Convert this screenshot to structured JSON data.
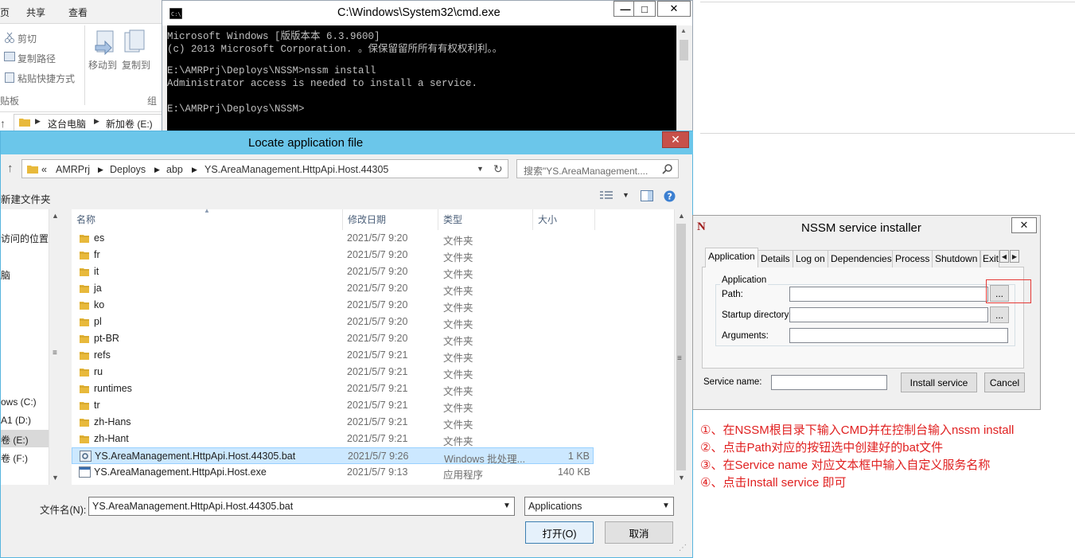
{
  "explorer": {
    "tabs": [
      "页",
      "共享",
      "查看"
    ],
    "commands": {
      "cut": "剪切",
      "copy_path": "复制路径",
      "paste_shortcut": "粘贴快捷方式",
      "move_to": "移动到",
      "copy_to": "复制到"
    },
    "groups": {
      "clipboard": "贴板",
      "organize": "组"
    },
    "breadcrumb": [
      "这台电脑",
      "新加卷 (E:)"
    ]
  },
  "cmd": {
    "title": "C:\\Windows\\System32\\cmd.exe",
    "lines": [
      "Microsoft Windows [版版本本 6.3.9600]",
      "(c) 2013 Microsoft Corporation. 。保保留留所所有有权权利利。。",
      "",
      "E:\\AMRPrj\\Deploys\\NSSM>nssm install",
      "Administrator access is needed to install a service.",
      "",
      "E:\\AMRPrj\\Deploys\\NSSM>"
    ],
    "min_label": "—",
    "max_label": "□",
    "close_label": "✕"
  },
  "dialog": {
    "title": "Locate application file",
    "close_label": "✕",
    "address": {
      "prefix": "«",
      "crumbs": [
        "AMRPrj",
        "Deploys",
        "abp",
        "YS.AreaManagement.HttpApi.Host.44305"
      ]
    },
    "search_placeholder": "搜索\"YS.AreaManagement....",
    "new_folder": "新建文件夹",
    "left_items": [
      "访问的位置",
      "脑",
      "ows (C:)",
      "A1 (D:)",
      "卷 (E:)",
      "卷 (F:)"
    ],
    "columns": {
      "name": "名称",
      "date": "修改日期",
      "type": "类型",
      "size": "大小"
    },
    "files": [
      {
        "name": "es",
        "date": "2021/5/7 9:20",
        "type": "文件夹",
        "size": "",
        "icon": "folder-icon",
        "selected": false
      },
      {
        "name": "fr",
        "date": "2021/5/7 9:20",
        "type": "文件夹",
        "size": "",
        "icon": "folder-icon",
        "selected": false
      },
      {
        "name": "it",
        "date": "2021/5/7 9:20",
        "type": "文件夹",
        "size": "",
        "icon": "folder-icon",
        "selected": false
      },
      {
        "name": "ja",
        "date": "2021/5/7 9:20",
        "type": "文件夹",
        "size": "",
        "icon": "folder-icon",
        "selected": false
      },
      {
        "name": "ko",
        "date": "2021/5/7 9:20",
        "type": "文件夹",
        "size": "",
        "icon": "folder-icon",
        "selected": false
      },
      {
        "name": "pl",
        "date": "2021/5/7 9:20",
        "type": "文件夹",
        "size": "",
        "icon": "folder-icon",
        "selected": false
      },
      {
        "name": "pt-BR",
        "date": "2021/5/7 9:20",
        "type": "文件夹",
        "size": "",
        "icon": "folder-icon",
        "selected": false
      },
      {
        "name": "refs",
        "date": "2021/5/7 9:21",
        "type": "文件夹",
        "size": "",
        "icon": "folder-icon",
        "selected": false
      },
      {
        "name": "ru",
        "date": "2021/5/7 9:21",
        "type": "文件夹",
        "size": "",
        "icon": "folder-icon",
        "selected": false
      },
      {
        "name": "runtimes",
        "date": "2021/5/7 9:21",
        "type": "文件夹",
        "size": "",
        "icon": "folder-icon",
        "selected": false
      },
      {
        "name": "tr",
        "date": "2021/5/7 9:21",
        "type": "文件夹",
        "size": "",
        "icon": "folder-icon",
        "selected": false
      },
      {
        "name": "zh-Hans",
        "date": "2021/5/7 9:21",
        "type": "文件夹",
        "size": "",
        "icon": "folder-icon",
        "selected": false
      },
      {
        "name": "zh-Hant",
        "date": "2021/5/7 9:21",
        "type": "文件夹",
        "size": "",
        "icon": "folder-icon",
        "selected": false
      },
      {
        "name": "YS.AreaManagement.HttpApi.Host.44305.bat",
        "date": "2021/5/7 9:26",
        "type": "Windows 批处理...",
        "size": "1 KB",
        "icon": "batch-file-icon",
        "selected": true
      },
      {
        "name": "YS.AreaManagement.HttpApi.Host.exe",
        "date": "2021/5/7 9:13",
        "type": "应用程序",
        "size": "140 KB",
        "icon": "exe-file-icon",
        "selected": false
      }
    ],
    "filename_label": "文件名(N):",
    "filename_value": "YS.AreaManagement.HttpApi.Host.44305.bat",
    "filter_value": "Applications",
    "open_label": "打开(O)",
    "cancel_label": "取消"
  },
  "nssm": {
    "logo": "N",
    "title": "NSSM service installer",
    "close_label": "✕",
    "tabs": [
      "Application",
      "Details",
      "Log on",
      "Dependencies",
      "Process",
      "Shutdown",
      "Exit"
    ],
    "group_label": "Application",
    "path_label": "Path:",
    "startup_label": "Startup directory:",
    "args_label": "Arguments:",
    "browse_label": "...",
    "service_name_label": "Service name:",
    "install_label": "Install service",
    "cancel_label": "Cancel"
  },
  "notes": [
    "①、在NSSM根目录下输入CMD并在控制台输入nssm install",
    "②、点击Path对应的按钮选中创建好的bat文件",
    "③、在Service name 对应文本框中输入自定义服务名称",
    "④、点击Install service 即可"
  ],
  "colors": {
    "annotation": "#e02020",
    "dialog_title": "#6bc6ea",
    "selection": "#cce8ff"
  }
}
